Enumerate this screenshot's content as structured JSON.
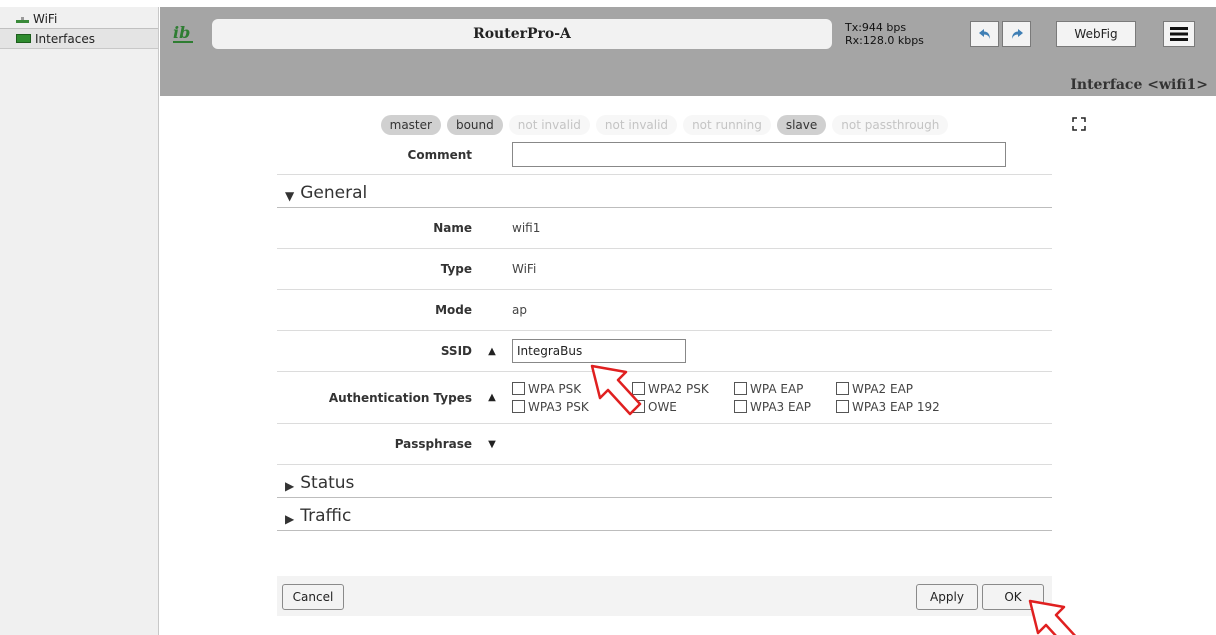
{
  "sidebar": {
    "items": [
      {
        "label": "WiFi",
        "icon": "wifi-icon"
      },
      {
        "label": "Interfaces",
        "icon": "interfaces-icon"
      }
    ]
  },
  "header": {
    "router_name": "RouterPro-A",
    "tx": "Tx:944 bps",
    "rx": "Rx:128.0 kbps",
    "webfig_label": "WebFig",
    "page_heading": "Interface <wifi1>"
  },
  "flags": [
    {
      "label": "master",
      "state": "on"
    },
    {
      "label": "bound",
      "state": "on"
    },
    {
      "label": "not invalid",
      "state": "off"
    },
    {
      "label": "not invalid",
      "state": "off"
    },
    {
      "label": "not running",
      "state": "off"
    },
    {
      "label": "slave",
      "state": "on"
    },
    {
      "label": "not passthrough",
      "state": "off"
    }
  ],
  "form": {
    "comment_label": "Comment",
    "comment_value": "",
    "general_section": "General",
    "name_label": "Name",
    "name_value": "wifi1",
    "type_label": "Type",
    "type_value": "WiFi",
    "mode_label": "Mode",
    "mode_value": "ap",
    "ssid_label": "SSID",
    "ssid_value": "IntegraBus",
    "auth_label": "Authentication Types",
    "auth_options": [
      "WPA PSK",
      "WPA2 PSK",
      "WPA EAP",
      "WPA2 EAP",
      "WPA3 PSK",
      "OWE",
      "WPA3 EAP",
      "WPA3 EAP 192"
    ],
    "passphrase_label": "Passphrase",
    "status_section": "Status",
    "traffic_section": "Traffic"
  },
  "actions": {
    "cancel": "Cancel",
    "apply": "Apply",
    "ok": "OK"
  },
  "colors": {
    "header_bg": "#a5a5a5",
    "sidebar_bg": "#f0f0f0",
    "annotation_red": "#e02020",
    "logo_green": "#2e7d32"
  }
}
